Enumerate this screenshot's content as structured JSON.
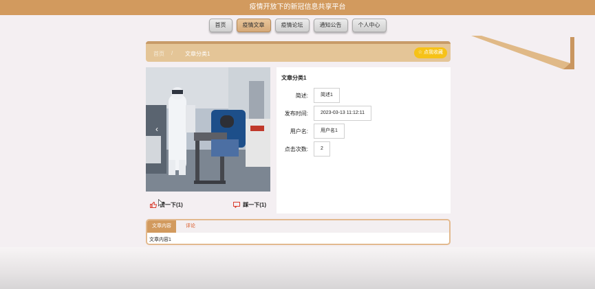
{
  "header": {
    "title": "疫情开放下的新冠信息共享平台"
  },
  "nav": {
    "items": [
      {
        "label": "首页"
      },
      {
        "label": "疫情文章"
      },
      {
        "label": "疫情论坛"
      },
      {
        "label": "通知公告"
      },
      {
        "label": "个人中心"
      }
    ],
    "active_index": 1
  },
  "breadcrumb": {
    "home": "首页",
    "separator": "/",
    "current": "文章分类1"
  },
  "collect_button": {
    "label": "☆ 点我收藏"
  },
  "photo": {
    "prev_glyph": "‹"
  },
  "votes": {
    "up_label": "赞一下(1)",
    "down_label": "踩一下(1)"
  },
  "article": {
    "title": "文章分类1",
    "fields": [
      {
        "label": "简述:",
        "value": "简述1"
      },
      {
        "label": "发布时间:",
        "value": "2023-03-13 11:12:11"
      },
      {
        "label": "用户名:",
        "value": "用户名1"
      },
      {
        "label": "点击次数:",
        "value": "2"
      }
    ]
  },
  "tabs": {
    "items": [
      {
        "label": "文章内容"
      },
      {
        "label": "评论"
      }
    ],
    "content": "文章内容1"
  },
  "colors": {
    "topbar": "#d29a5e",
    "accent": "#e4c597",
    "collect": "#f6c218",
    "tab_active": "#d29a5e",
    "tab_link": "#d9531e"
  }
}
